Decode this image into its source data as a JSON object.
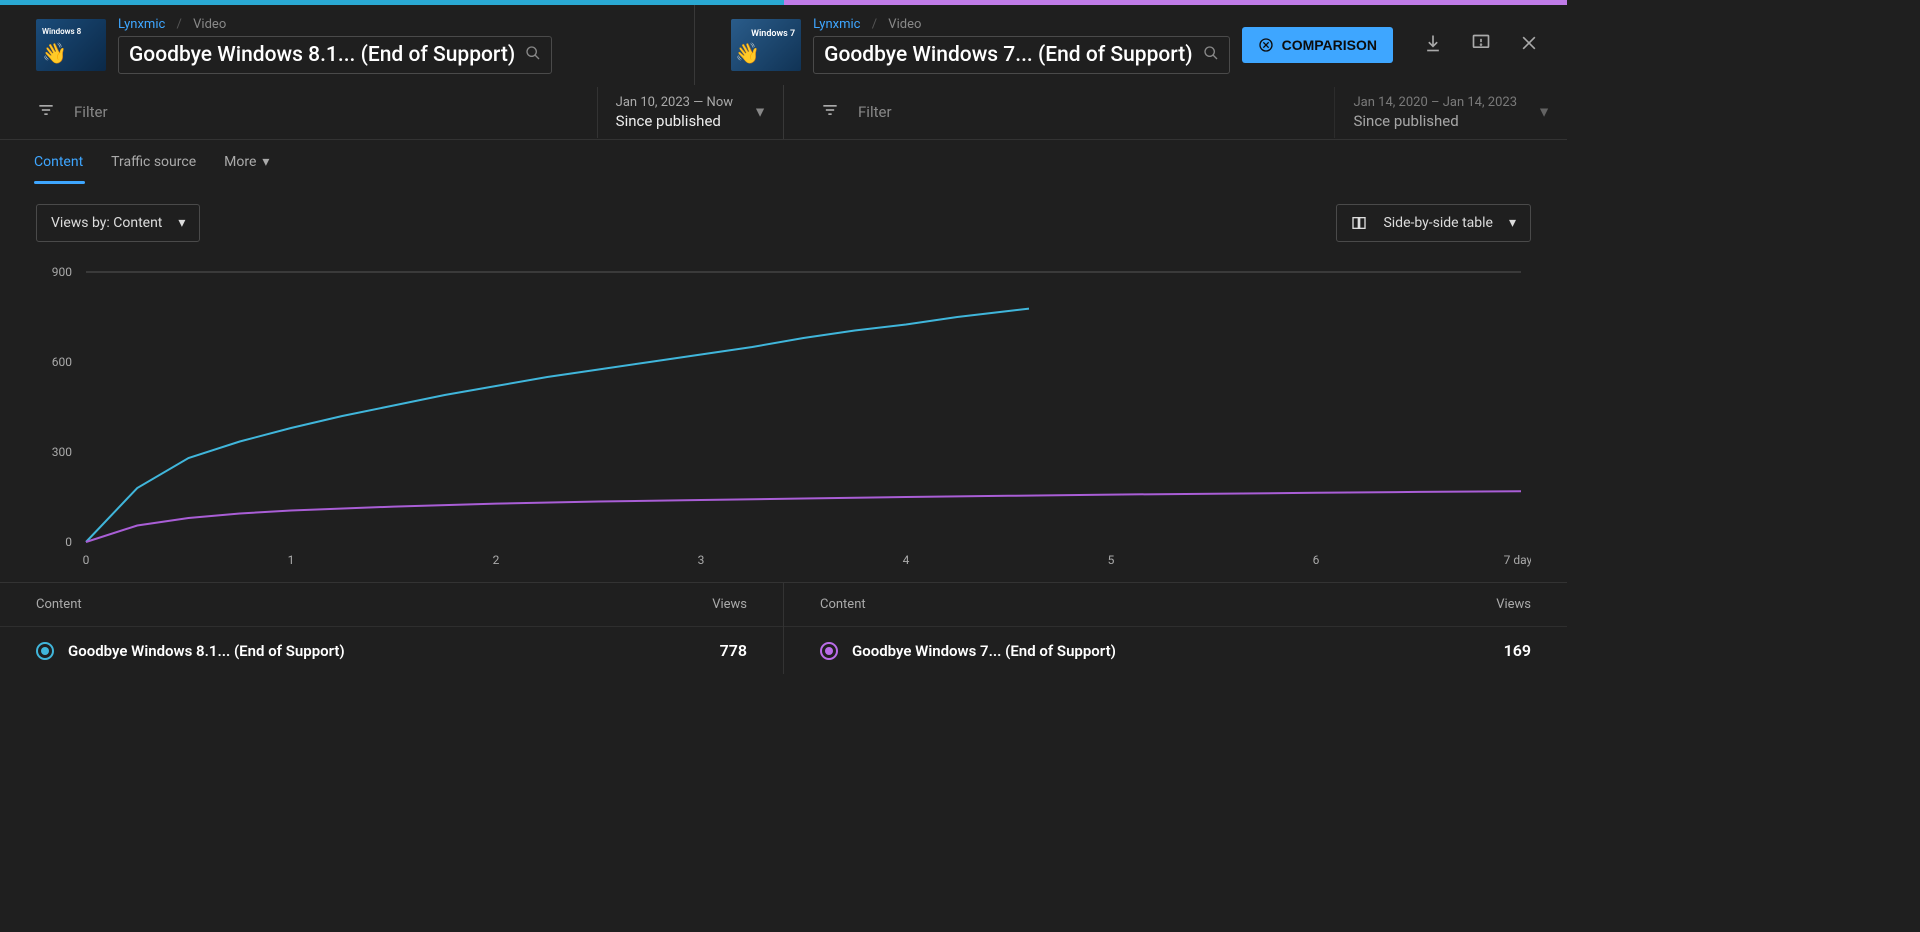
{
  "colors": {
    "series1": "#40b6db",
    "series2": "#a95ed6",
    "accent": "#3ea6ff"
  },
  "left": {
    "breadcrumb_channel": "Lynxmic",
    "breadcrumb_type": "Video",
    "title": "Goodbye Windows 8.1... (End of Support)",
    "thumb_label": "Windows 8",
    "filter_placeholder": "Filter",
    "date_range": "Jan 10, 2023 — Now",
    "date_label": "Since published"
  },
  "right": {
    "breadcrumb_channel": "Lynxmic",
    "breadcrumb_type": "Video",
    "title": "Goodbye Windows 7... (End of Support)",
    "thumb_label": "Windows 7",
    "filter_placeholder": "Filter",
    "date_range": "Jan 14, 2020 – Jan 14, 2023",
    "date_label": "Since published"
  },
  "comparison_btn": "COMPARISON",
  "tabs": {
    "content": "Content",
    "traffic": "Traffic source",
    "more": "More"
  },
  "views_by": "Views by: Content",
  "side_by_side": "Side-by-side table",
  "table": {
    "header_content": "Content",
    "header_views": "Views",
    "left_title": "Goodbye Windows 8.1... (End of Support)",
    "left_views": "778",
    "right_title": "Goodbye Windows 7... (End of Support)",
    "right_views": "169"
  },
  "chart_data": {
    "type": "line",
    "xlabel": "days",
    "ylabel": "",
    "x_ticks": [
      0,
      1,
      2,
      3,
      4,
      5,
      6,
      7
    ],
    "x_tick_suffix": "7 days",
    "y_ticks": [
      0,
      300,
      600,
      900
    ],
    "ylim": [
      0,
      900
    ],
    "xlim": [
      0,
      7
    ],
    "series": [
      {
        "name": "Goodbye Windows 8.1... (End of Support)",
        "color": "#40b6db",
        "x": [
          0,
          0.25,
          0.5,
          0.75,
          1,
          1.25,
          1.5,
          1.75,
          2,
          2.25,
          2.5,
          2.75,
          3,
          3.25,
          3.5,
          3.75,
          4,
          4.25,
          4.5,
          4.6
        ],
        "y": [
          0,
          180,
          280,
          335,
          380,
          420,
          455,
          490,
          520,
          550,
          575,
          600,
          625,
          650,
          680,
          705,
          725,
          750,
          770,
          778
        ]
      },
      {
        "name": "Goodbye Windows 7... (End of Support)",
        "color": "#a95ed6",
        "x": [
          0,
          0.25,
          0.5,
          0.75,
          1,
          1.5,
          2,
          2.5,
          3,
          3.5,
          4,
          4.5,
          5,
          5.5,
          6,
          6.5,
          7
        ],
        "y": [
          0,
          55,
          80,
          95,
          105,
          118,
          128,
          135,
          140,
          145,
          150,
          154,
          158,
          161,
          164,
          167,
          169
        ]
      }
    ]
  }
}
